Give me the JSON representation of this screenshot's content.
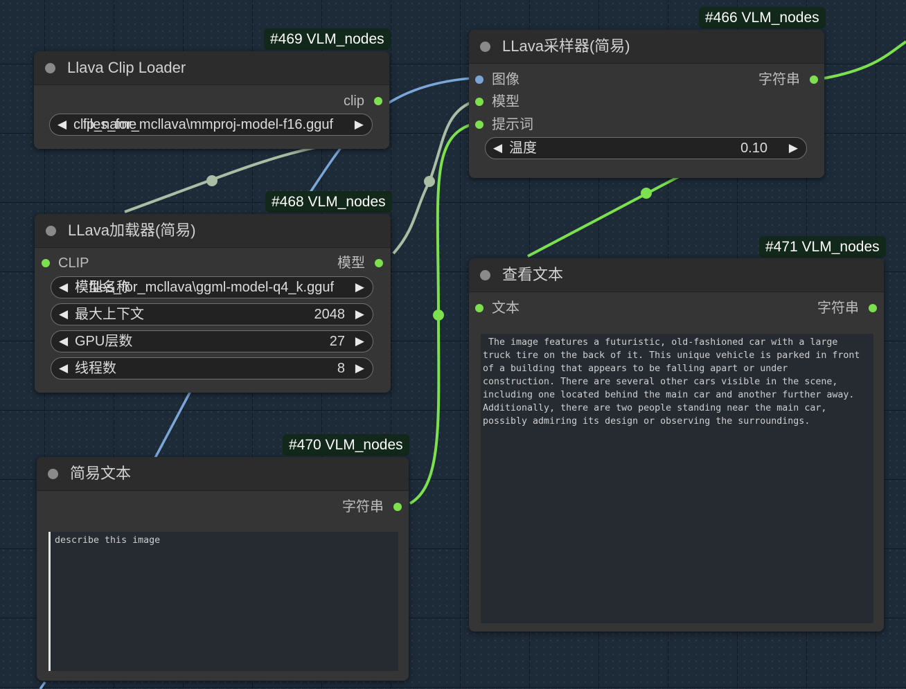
{
  "colors": {
    "canvas": "#1d2a38",
    "node_body": "#353535",
    "node_header": "#2c2c2c",
    "link_green": "#7ce04f",
    "link_blue": "#7aa7d8",
    "link_gray": "#a9bea4",
    "badge_bg": "#12281a"
  },
  "nodes": {
    "clip_loader": {
      "badge": "#469 VLM_nodes",
      "title": "Llava Clip Loader",
      "output": "clip",
      "widget": {
        "label": "clip_name",
        "value": "files_for_mcllava\\mmproj-model-f16.gguf"
      }
    },
    "llava_loader": {
      "badge": "#468 VLM_nodes",
      "title": "LLava加载器(简易)",
      "input": "CLIP",
      "output": "模型",
      "widgets": [
        {
          "label": "模型名称",
          "value": "files_for_mcllava\\ggml-model-q4_k.gguf"
        },
        {
          "label": "最大上下文",
          "value": "2048"
        },
        {
          "label": "GPU层数",
          "value": "27"
        },
        {
          "label": "线程数",
          "value": "8"
        }
      ]
    },
    "simple_text": {
      "badge": "#470 VLM_nodes",
      "title": "简易文本",
      "output": "字符串",
      "text": "describe this image"
    },
    "sampler": {
      "badge": "#466 VLM_nodes",
      "title": "LLava采样器(简易)",
      "inputs": [
        "图像",
        "模型",
        "提示词"
      ],
      "output": "字符串",
      "widget": {
        "label": "温度",
        "value": "0.10"
      }
    },
    "show_text": {
      "badge": "#471 VLM_nodes",
      "title": "查看文本",
      "input": "文本",
      "output": "字符串",
      "text": " The image features a futuristic, old-fashioned car with a large\ntruck tire on the back of it. This unique vehicle is parked in front\nof a building that appears to be falling apart or under\nconstruction. There are several other cars visible in the scene,\nincluding one located behind the main car and another further away.\nAdditionally, there are two people standing near the main car,\npossibly admiring its design or observing the surroundings."
    }
  },
  "icons": {
    "arrow_left": "◀",
    "arrow_right": "▶"
  }
}
